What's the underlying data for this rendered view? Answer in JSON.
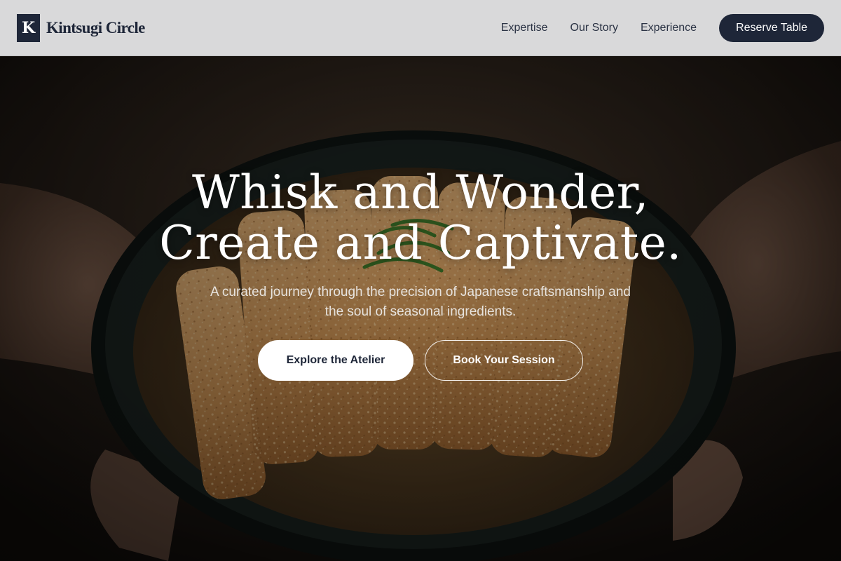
{
  "header": {
    "brand": {
      "mark": "K",
      "name": "Kintsugi Circle"
    },
    "nav": [
      {
        "label": "Expertise"
      },
      {
        "label": "Our Story"
      },
      {
        "label": "Experience"
      }
    ],
    "cta_label": "Reserve Table"
  },
  "hero": {
    "title_lines": [
      "Whisk and Wonder,",
      "Create and Captivate."
    ],
    "subtitle_lines": [
      "A curated journey through the precision of Japanese craftsmanship and",
      "the soul of seasonal ingredients."
    ],
    "primary_cta": "Explore the Atelier",
    "secondary_cta": "Book Your Session",
    "image": "bowl-of-katsu-held-in-hands"
  },
  "colors": {
    "navy": "#1e2638",
    "header_bg": "#d9d9da",
    "white": "#ffffff"
  }
}
